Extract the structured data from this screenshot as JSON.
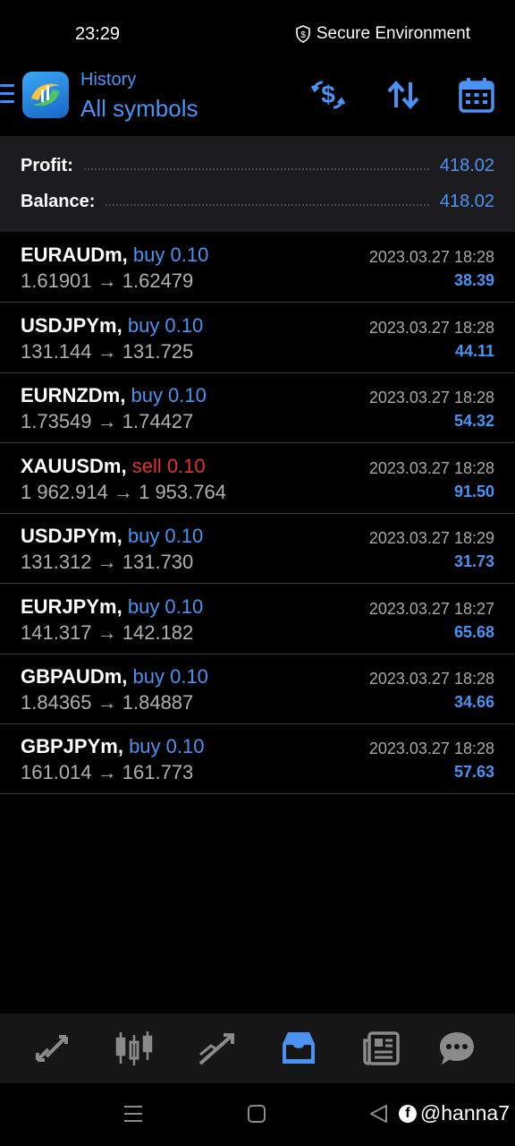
{
  "status_bar": {
    "time": "23:29",
    "secure_label": "Secure Environment"
  },
  "header": {
    "subtitle": "History",
    "title": "All symbols"
  },
  "summary": {
    "profit_label": "Profit:",
    "profit_value": "418.02",
    "balance_label": "Balance:",
    "balance_value": "418.02"
  },
  "trades": [
    {
      "symbol": "EURAUDm,",
      "side": "buy 0.10",
      "prices": "1.61901 → 1.62479",
      "time": "2023.03.27 18:28",
      "profit": "38.39"
    },
    {
      "symbol": "USDJPYm,",
      "side": "buy 0.10",
      "prices": "131.144 → 131.725",
      "time": "2023.03.27 18:28",
      "profit": "44.11"
    },
    {
      "symbol": "EURNZDm,",
      "side": "buy 0.10",
      "prices": "1.73549 → 1.74427",
      "time": "2023.03.27 18:28",
      "profit": "54.32"
    },
    {
      "symbol": "XAUUSDm,",
      "side": "sell 0.10",
      "prices": "1 962.914 → 1 953.764",
      "time": "2023.03.27 18:28",
      "profit": "91.50"
    },
    {
      "symbol": "USDJPYm,",
      "side": "buy 0.10",
      "prices": "131.312 → 131.730",
      "time": "2023.03.27 18:29",
      "profit": "31.73"
    },
    {
      "symbol": "EURJPYm,",
      "side": "buy 0.10",
      "prices": "141.317 → 142.182",
      "time": "2023.03.27 18:27",
      "profit": "65.68"
    },
    {
      "symbol": "GBPAUDm,",
      "side": "buy 0.10",
      "prices": "1.84365 → 1.84887",
      "time": "2023.03.27 18:28",
      "profit": "34.66"
    },
    {
      "symbol": "GBPJPYm,",
      "side": "buy 0.10",
      "prices": "161.014 → 161.773",
      "time": "2023.03.27 18:28",
      "profit": "57.63"
    }
  ],
  "bottom_nav": {
    "items": [
      "quotes-icon",
      "chart-icon",
      "trade-icon",
      "history-icon",
      "news-icon",
      "chat-icon"
    ],
    "active": "history-icon"
  },
  "watermark": {
    "text": "@hanna7"
  },
  "colors": {
    "accent": "#4b93f2",
    "sell": "#e0322e",
    "background": "#000000",
    "panel": "#1c1c1e"
  }
}
